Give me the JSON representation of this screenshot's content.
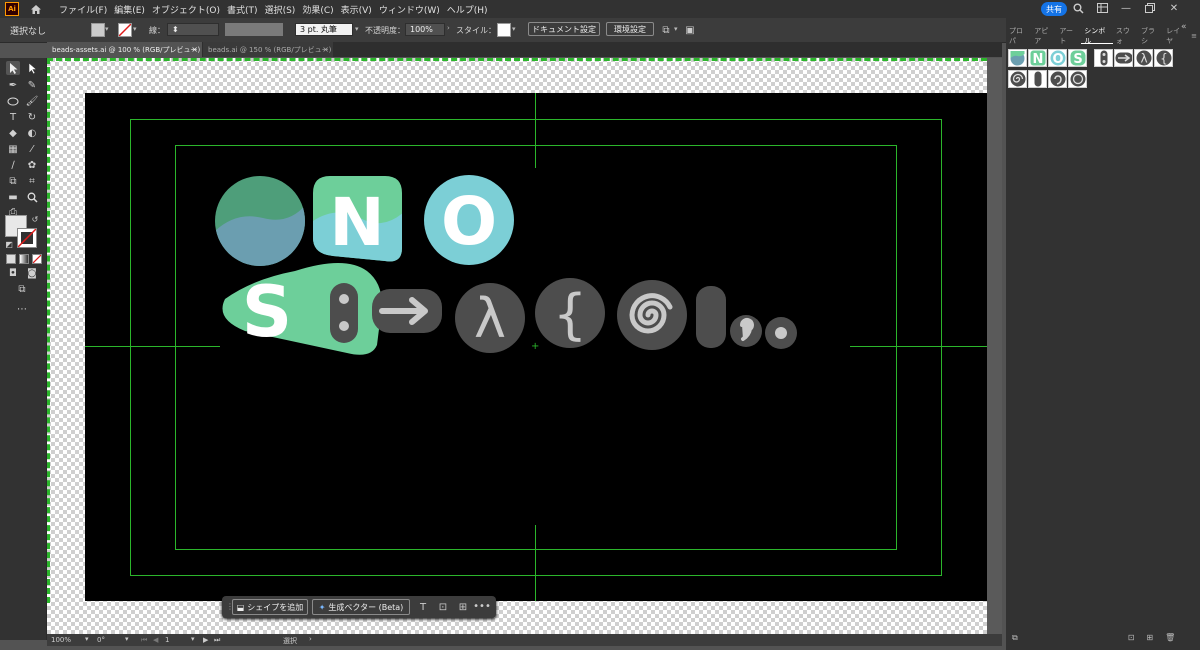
{
  "menubar": {
    "app_logo": "Ai",
    "items": [
      "ファイル(F)",
      "編集(E)",
      "オブジェクト(O)",
      "書式(T)",
      "選択(S)",
      "効果(C)",
      "表示(V)",
      "ウィンドウ(W)",
      "ヘルプ(H)"
    ],
    "share_label": "共有"
  },
  "control_bar": {
    "selection_label": "選択なし",
    "stroke_label": "線：",
    "stroke_style": "3 pt. 丸筆",
    "opacity_label": "不透明度：",
    "opacity_value": "100%",
    "style_label": "スタイル：",
    "document_settings_label": "ドキュメント設定",
    "preferences_label": "環境設定"
  },
  "tabs": [
    {
      "label": "beads-assets.ai @ 100 % (RGB/プレビュー)",
      "close": "×",
      "active": true
    },
    {
      "label": "beads.ai @ 150 % (RGB/プレビュー)",
      "close": "×",
      "active": false
    }
  ],
  "panel_tabs": [
    "プロパ",
    "アピア",
    "アート",
    "シンボル",
    "スウォ",
    "ブラシ",
    "レイヤ"
  ],
  "active_panel_tab": "シンボル",
  "artwork": {
    "letters": [
      "N",
      "O",
      "S"
    ],
    "symbols": [
      "λ",
      "{"
    ]
  },
  "context_bar": {
    "add_shape_label": "シェイプを追加",
    "gen_vector_label": "生成ベクター (Beta)",
    "more": "•••"
  },
  "statusbar": {
    "zoom": "100%",
    "rotation": "0°",
    "artboard": "1",
    "tool": "選択"
  },
  "colors": {
    "accent_green": "#6dcf9a",
    "accent_teal": "#7ccfd6",
    "guide": "#2bb52b",
    "bead_gray": "#4d4d4d",
    "share_blue": "#1473e6"
  }
}
